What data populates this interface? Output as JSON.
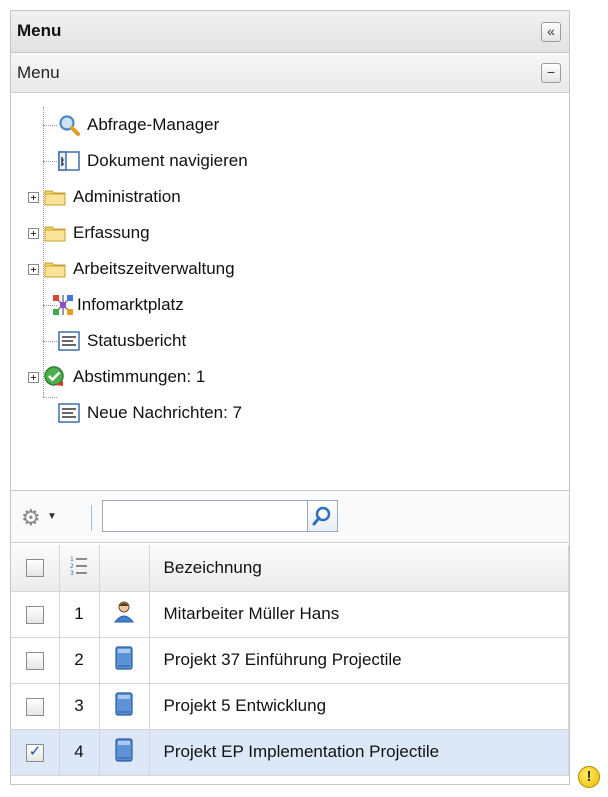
{
  "panel": {
    "title": "Menu",
    "collapse_glyph": "«"
  },
  "menu_section": {
    "title": "Menu",
    "toggle_glyph": "−"
  },
  "tree": [
    {
      "label": "Abfrage-Manager",
      "icon": "magnifier-icon",
      "expandable": false
    },
    {
      "label": "Dokument navigieren",
      "icon": "document-navigate-icon",
      "expandable": false
    },
    {
      "label": "Administration",
      "icon": "folder-icon",
      "expandable": true
    },
    {
      "label": "Erfassung",
      "icon": "folder-icon",
      "expandable": true
    },
    {
      "label": "Arbeitszeitverwaltung",
      "icon": "folder-icon",
      "expandable": true
    },
    {
      "label": "Infomarktplatz",
      "icon": "network-icon",
      "expandable": false
    },
    {
      "label": "Statusbericht",
      "icon": "report-icon",
      "expandable": false
    },
    {
      "label": "Abstimmungen: 1",
      "icon": "approval-icon",
      "expandable": true
    },
    {
      "label": "Neue Nachrichten: 7",
      "icon": "report-icon",
      "expandable": false
    }
  ],
  "toolbar": {
    "search_value": ""
  },
  "grid": {
    "column_header": "Bezeichnung",
    "rows": [
      {
        "num": "1",
        "icon": "person-icon",
        "label": "Mitarbeiter Müller Hans",
        "checked": false
      },
      {
        "num": "2",
        "icon": "project-icon",
        "label": "Projekt 37 Einführung Projectile",
        "checked": false
      },
      {
        "num": "3",
        "icon": "project-icon",
        "label": "Projekt 5 Entwicklung",
        "checked": false
      },
      {
        "num": "4",
        "icon": "project-icon",
        "label": "Projekt EP Implementation Projectile",
        "checked": true
      }
    ]
  },
  "colors": {
    "accent": "#2d6fc0",
    "folder": "#f3d36b",
    "selected_row": "#dce8f7"
  },
  "warning_glyph": "!"
}
